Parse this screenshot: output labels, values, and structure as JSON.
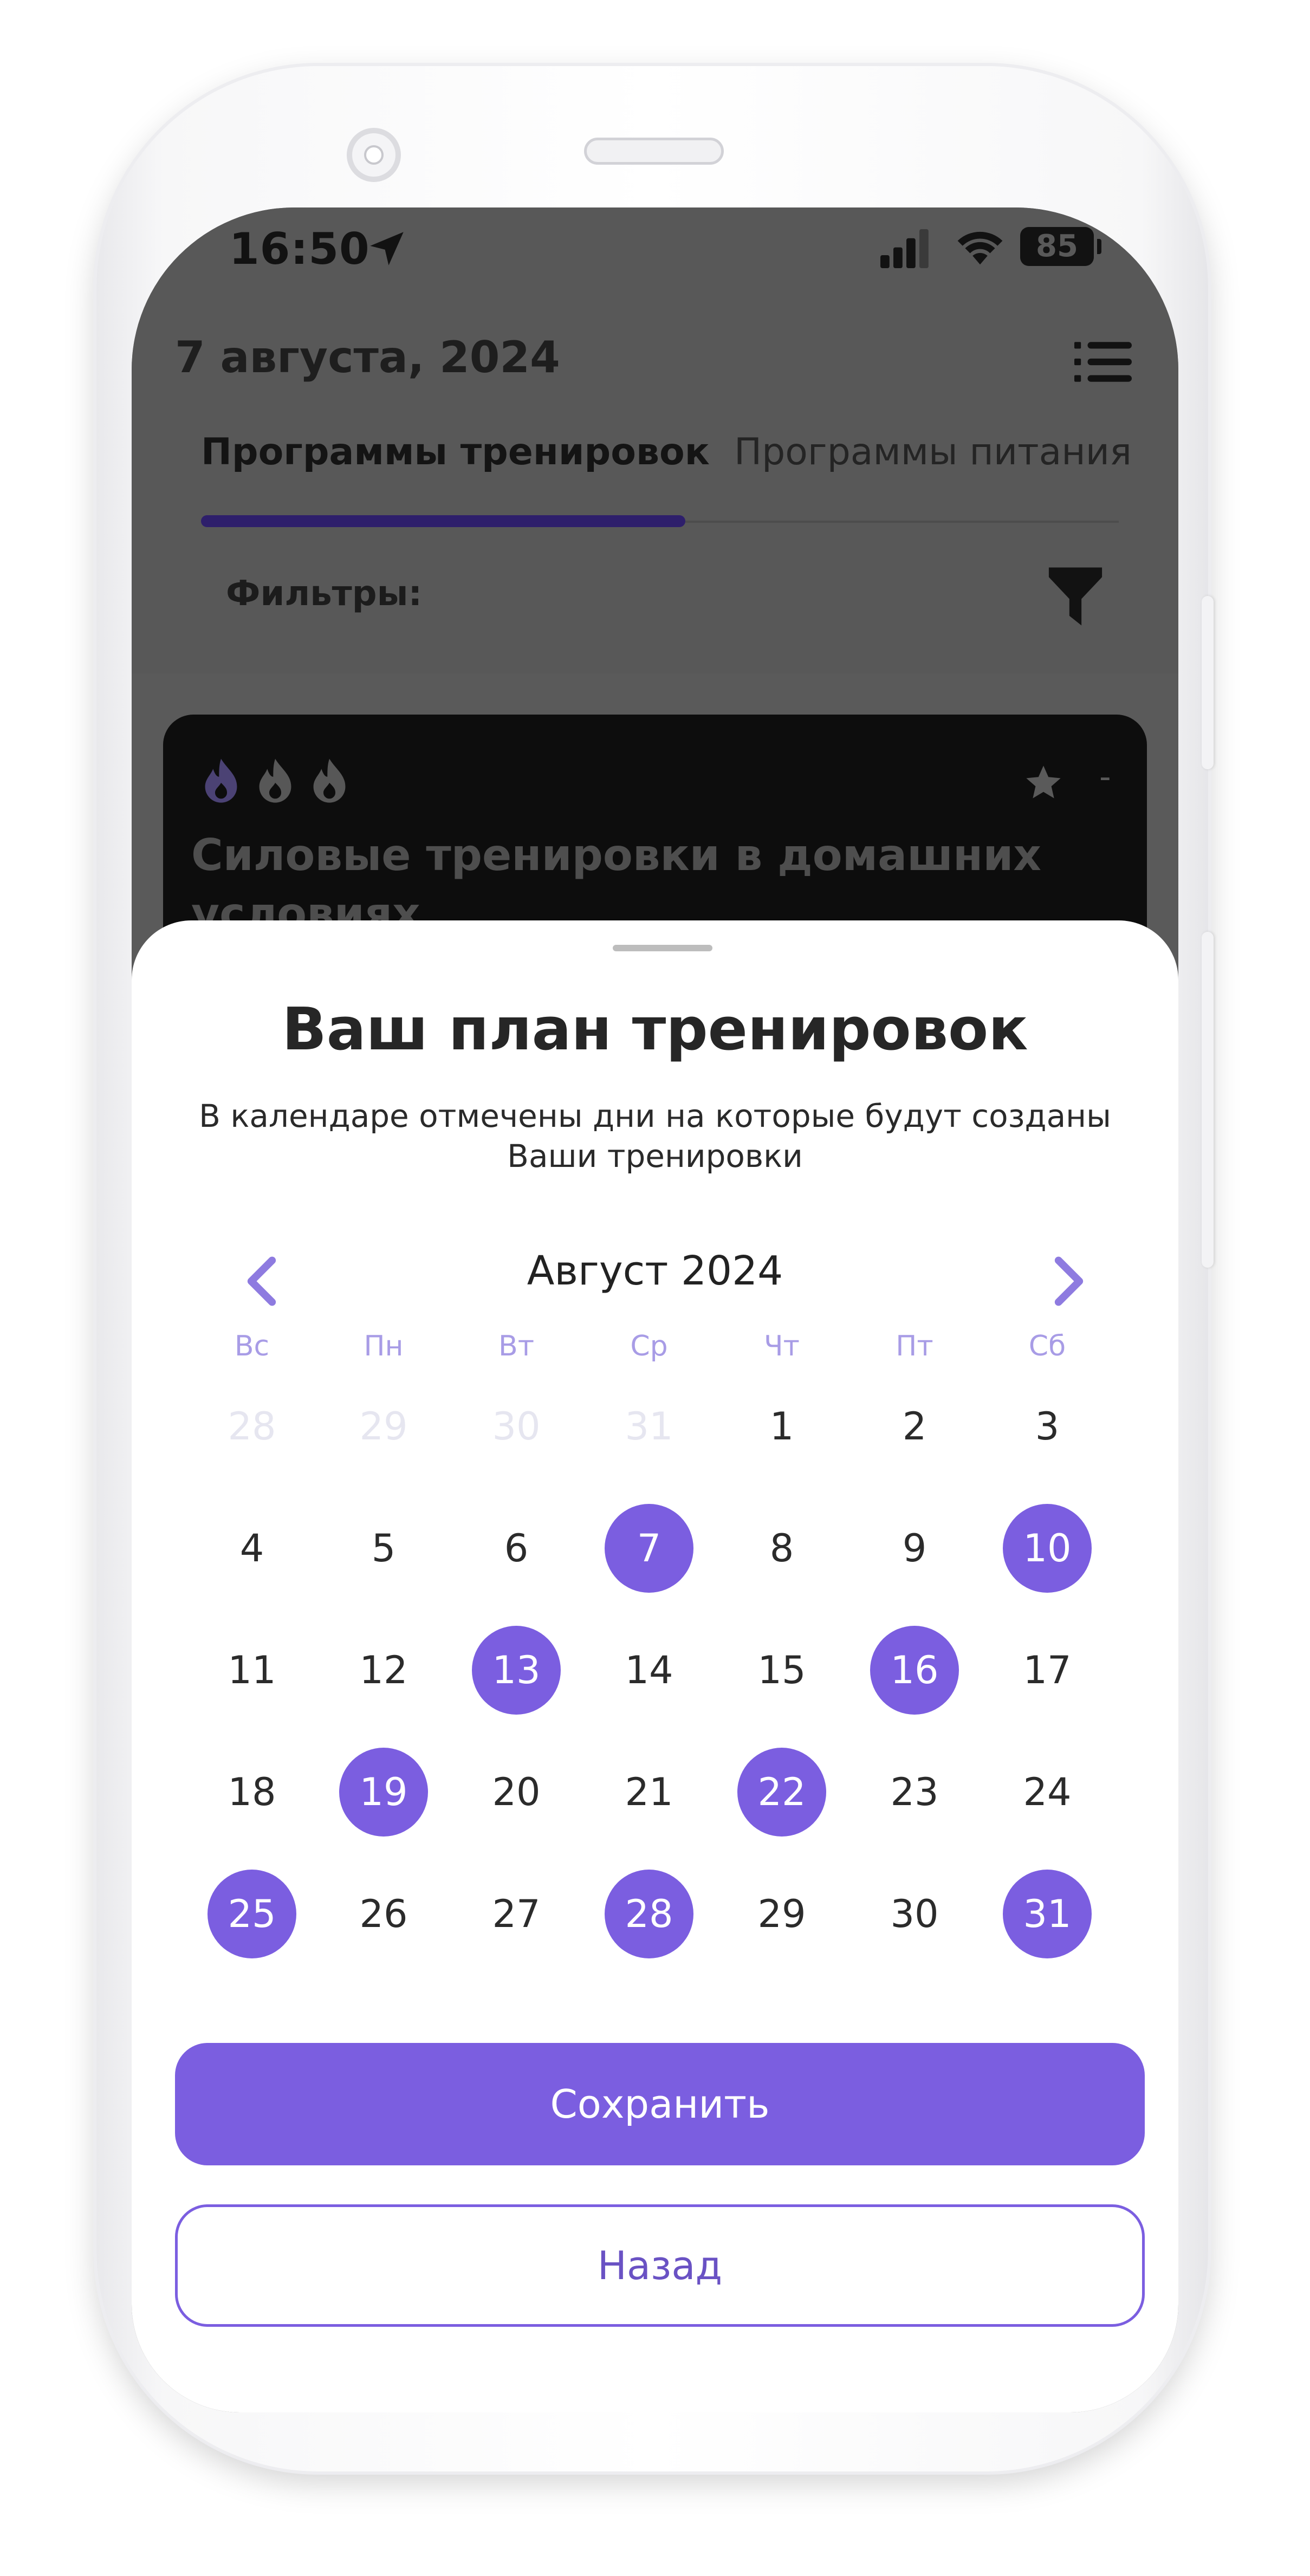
{
  "status_bar": {
    "time": "16:50",
    "battery": "85"
  },
  "header": {
    "date": "7 августа, 2024"
  },
  "tabs": [
    {
      "label": "Программы тренировок",
      "active": true
    },
    {
      "label": "Программы питания",
      "active": false
    }
  ],
  "filters": {
    "label": "Фильтры:"
  },
  "card": {
    "title": "Силовые тренировки в домашних условиях",
    "rating_dash": "-"
  },
  "sheet": {
    "title": "Ваш план тренировок",
    "subtitle": "В календаре отмечены дни на которые будут созданы Ваши тренировки",
    "month": "Август 2024",
    "weekdays": [
      "Вс",
      "Пн",
      "Вт",
      "Ср",
      "Чт",
      "Пт",
      "Сб"
    ],
    "weeks": [
      [
        {
          "d": "28",
          "muted": true
        },
        {
          "d": "29",
          "muted": true
        },
        {
          "d": "30",
          "muted": true
        },
        {
          "d": "31",
          "muted": true
        },
        {
          "d": "1"
        },
        {
          "d": "2"
        },
        {
          "d": "3"
        }
      ],
      [
        {
          "d": "4"
        },
        {
          "d": "5"
        },
        {
          "d": "6"
        },
        {
          "d": "7",
          "selected": true
        },
        {
          "d": "8"
        },
        {
          "d": "9"
        },
        {
          "d": "10",
          "selected": true
        }
      ],
      [
        {
          "d": "11"
        },
        {
          "d": "12"
        },
        {
          "d": "13",
          "selected": true
        },
        {
          "d": "14"
        },
        {
          "d": "15"
        },
        {
          "d": "16",
          "selected": true
        },
        {
          "d": "17"
        }
      ],
      [
        {
          "d": "18"
        },
        {
          "d": "19",
          "selected": true
        },
        {
          "d": "20"
        },
        {
          "d": "21"
        },
        {
          "d": "22",
          "selected": true
        },
        {
          "d": "23"
        },
        {
          "d": "24"
        }
      ],
      [
        {
          "d": "25",
          "selected": true
        },
        {
          "d": "26"
        },
        {
          "d": "27"
        },
        {
          "d": "28",
          "selected": true
        },
        {
          "d": "29"
        },
        {
          "d": "30"
        },
        {
          "d": "31",
          "selected": true
        }
      ]
    ],
    "save_label": "Сохранить",
    "back_label": "Назад"
  },
  "colors": {
    "accent": "#7b5ee0",
    "weekday": "#a89ce6",
    "dim_overlay": "#585858"
  },
  "icons": [
    "location-arrow-icon",
    "signal-icon",
    "wifi-icon",
    "battery-icon",
    "menu-icon",
    "filter-icon",
    "flame-icon",
    "star-icon",
    "chevron-left-icon",
    "chevron-right-icon"
  ]
}
